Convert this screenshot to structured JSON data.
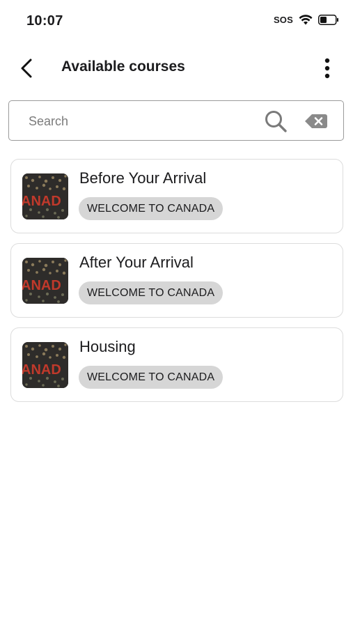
{
  "status_bar": {
    "time": "10:07",
    "sos": "SOS",
    "wifi_icon": "wifi-icon",
    "battery_icon": "battery-icon"
  },
  "header": {
    "title": "Available courses",
    "back_icon": "chevron-left-icon",
    "more_icon": "more-vertical-icon"
  },
  "search": {
    "placeholder": "Search",
    "value": "",
    "search_icon": "search-icon",
    "clear_icon": "backspace-clear-icon"
  },
  "courses": [
    {
      "title": "Before Your Arrival",
      "tag": "WELCOME TO CANADA",
      "thumbnail_text": "ANAD"
    },
    {
      "title": "After Your Arrival",
      "tag": "WELCOME TO CANADA",
      "thumbnail_text": "ANAD"
    },
    {
      "title": "Housing",
      "tag": "WELCOME TO CANADA",
      "thumbnail_text": "ANAD"
    }
  ],
  "colors": {
    "tag_background": "#d6d6d6",
    "card_border": "#dcdcdc",
    "search_border": "#9a9a9a",
    "text_primary": "#1c1c1e",
    "thumb_letters": "#c0392b"
  }
}
